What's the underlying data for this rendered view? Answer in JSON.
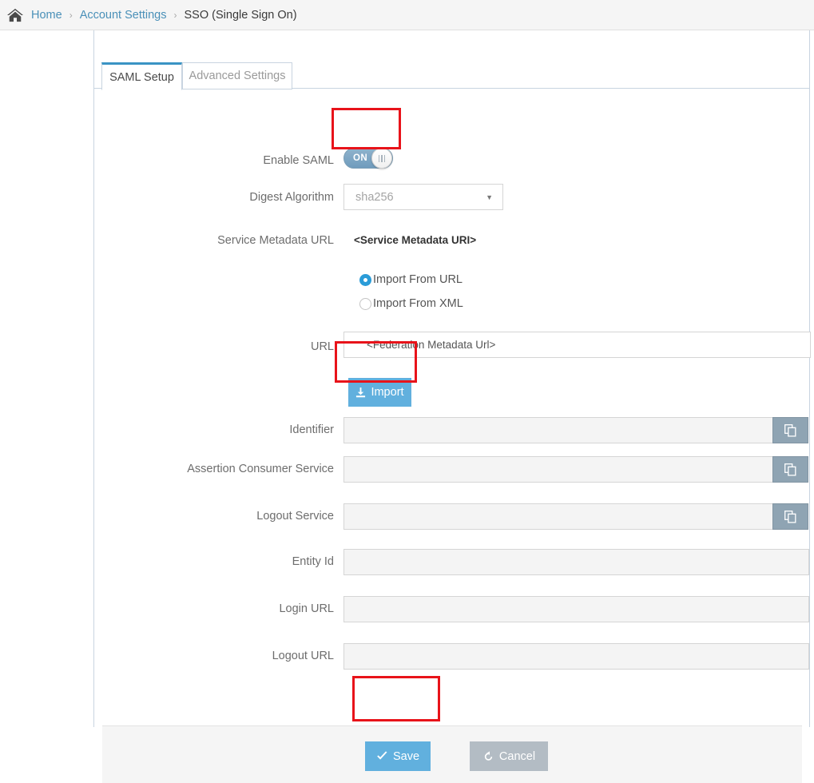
{
  "breadcrumb": {
    "home_icon": "home-icon",
    "items": [
      {
        "label": "Home",
        "type": "link"
      },
      {
        "label": "Account Settings",
        "type": "link"
      },
      {
        "label": "SSO (Single Sign On)",
        "type": "current"
      }
    ],
    "separator": "›"
  },
  "tabs": [
    {
      "label": "SAML Setup",
      "active": true
    },
    {
      "label": "Advanced Settings",
      "active": false
    }
  ],
  "form": {
    "enable_saml": {
      "label": "Enable SAML",
      "toggle_state": "ON",
      "toggle_on": true
    },
    "digest_algorithm": {
      "label": "Digest Algorithm",
      "value": "sha256",
      "caret": "▼"
    },
    "service_metadata_url": {
      "label": "Service Metadata URL",
      "value": "<Service Metadata URI>"
    },
    "import_source": {
      "options": [
        {
          "label": "Import From URL",
          "selected": true
        },
        {
          "label": "Import From XML",
          "selected": false
        }
      ]
    },
    "url": {
      "label": "URL",
      "value": "<Federation Metadata Url>"
    },
    "import_button": {
      "label": "Import",
      "icon": "download-icon"
    },
    "identifier": {
      "label": "Identifier",
      "value": "",
      "copy_icon": "copy-icon"
    },
    "assertion_consumer_service": {
      "label": "Assertion Consumer Service",
      "value": "",
      "copy_icon": "copy-icon"
    },
    "logout_service": {
      "label": "Logout Service",
      "value": "",
      "copy_icon": "copy-icon"
    },
    "entity_id": {
      "label": "Entity Id",
      "value": ""
    },
    "login_url": {
      "label": "Login URL",
      "value": ""
    },
    "logout_url": {
      "label": "Logout URL",
      "value": ""
    }
  },
  "footer": {
    "save_button": {
      "label": "Save",
      "icon": "check-icon"
    },
    "cancel_button": {
      "label": "Cancel",
      "icon": "undo-icon"
    }
  },
  "colors": {
    "accent_blue": "#61b0de",
    "tab_active_border": "#3a93c4",
    "link_blue": "#4a90b8",
    "highlight_red": "#e8131a",
    "copy_button": "#8fa4b3",
    "cancel_gray": "#b3bcc4",
    "toggle_on": "#7b9db5"
  },
  "highlights": [
    {
      "target": "enable-saml-toggle"
    },
    {
      "target": "import-button"
    },
    {
      "target": "save-button"
    }
  ]
}
